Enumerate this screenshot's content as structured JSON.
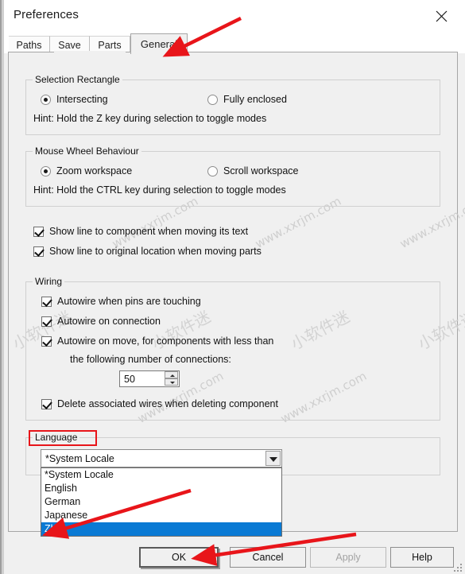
{
  "window": {
    "title": "Preferences",
    "close_icon": "close-icon"
  },
  "tabs": [
    {
      "label": "Paths",
      "active": false
    },
    {
      "label": "Save",
      "active": false
    },
    {
      "label": "Parts",
      "active": false
    },
    {
      "label": "General",
      "active": true
    }
  ],
  "groups": {
    "selection_rectangle": {
      "caption": "Selection Rectangle",
      "options": [
        {
          "label": "Intersecting",
          "checked": true
        },
        {
          "label": "Fully enclosed",
          "checked": false
        }
      ],
      "hint": "Hint: Hold the Z key during selection to toggle modes"
    },
    "mouse_wheel": {
      "caption": "Mouse Wheel Behaviour",
      "options": [
        {
          "label": "Zoom workspace",
          "checked": true
        },
        {
          "label": "Scroll workspace",
          "checked": false
        }
      ],
      "hint": "Hint: Hold the CTRL key during selection to toggle modes"
    },
    "wiring": {
      "caption": "Wiring",
      "checkboxes": [
        {
          "label": "Autowire when pins are touching",
          "checked": true
        },
        {
          "label": "Autowire on connection",
          "checked": true
        },
        {
          "label": "Autowire on move, for components with less than",
          "checked": true
        },
        {
          "label": "Delete associated wires when deleting component",
          "checked": true
        }
      ],
      "sub_label": "the following number of connections:",
      "spinner": {
        "value": "50"
      }
    },
    "language": {
      "caption": "Language",
      "combo_value": "*System Locale",
      "options": [
        {
          "label": "*System Locale",
          "selected": false
        },
        {
          "label": "English",
          "selected": false
        },
        {
          "label": "German",
          "selected": false
        },
        {
          "label": "Japanese",
          "selected": false
        },
        {
          "label": "Zh",
          "selected": true
        }
      ]
    }
  },
  "standalone_checkboxes": [
    {
      "label": "Show line to component when moving its text",
      "checked": true
    },
    {
      "label": "Show line to original location when moving parts",
      "checked": true
    }
  ],
  "footer": {
    "ok": "OK",
    "cancel": "Cancel",
    "apply": "Apply",
    "help": "Help"
  },
  "watermarks": {
    "latin": "www.xxrjm.com",
    "cjk": "小软件迷"
  },
  "colors": {
    "highlight": "#0a7ad4",
    "annotation": "#e8151a",
    "dialog_bg": "#f0f0f0"
  }
}
